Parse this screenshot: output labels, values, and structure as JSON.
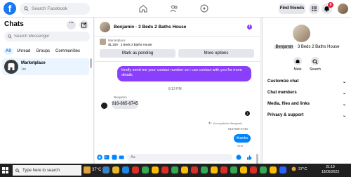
{
  "topbar": {
    "search_placeholder": "Search Facebook",
    "find_friends": "Find friends",
    "notification_count": "6"
  },
  "sidebar": {
    "title": "Chats",
    "more_label": "···",
    "search_placeholder": "Search Messenger",
    "filters": [
      "All",
      "Unread",
      "Groups",
      "Communities"
    ],
    "active_filter": "All",
    "conversation": {
      "name": "Marketplace",
      "time": "1m"
    }
  },
  "chat": {
    "title": "Benjamin · 3 Beds 2 Baths House",
    "info_label": "i",
    "listing": {
      "name": "Marketplace",
      "price_title": "$1,200 · 3 Beds 2 Baths House",
      "mark_pending": "Mark as pending",
      "more_options": "More options"
    },
    "messages": {
      "outgoing_1": "kindly send me your contact number so i can contact with you for more details",
      "timestamp": "8:13 PM",
      "sender": "Benjamin",
      "incoming_1": "916-865-6745",
      "info_label": "i",
      "replied_label": "You replied to Benjamin",
      "quoted": "916-865-6745",
      "outgoing_2": "thanks",
      "status": "Sent"
    },
    "composer_placeholder": "Aa"
  },
  "details": {
    "title_highlight": "Benjamin",
    "title_rest": " · 3 Beds 2 Baths House",
    "actions": [
      "Mute",
      "Search"
    ],
    "sections": [
      "Customize chat",
      "Chat members",
      "Media, files and links",
      "Privacy & support"
    ]
  },
  "taskbar": {
    "search_placeholder": "Type here to search",
    "weather_temp": "37°C",
    "temp": "37°C",
    "time": "21:19",
    "date": "18/06/2023"
  },
  "colors": {
    "brand": "#1877f2",
    "outgoing_bubble": "#8a3ffc",
    "thanks_bubble": "#0084ff",
    "badge": "#e41e3f"
  }
}
